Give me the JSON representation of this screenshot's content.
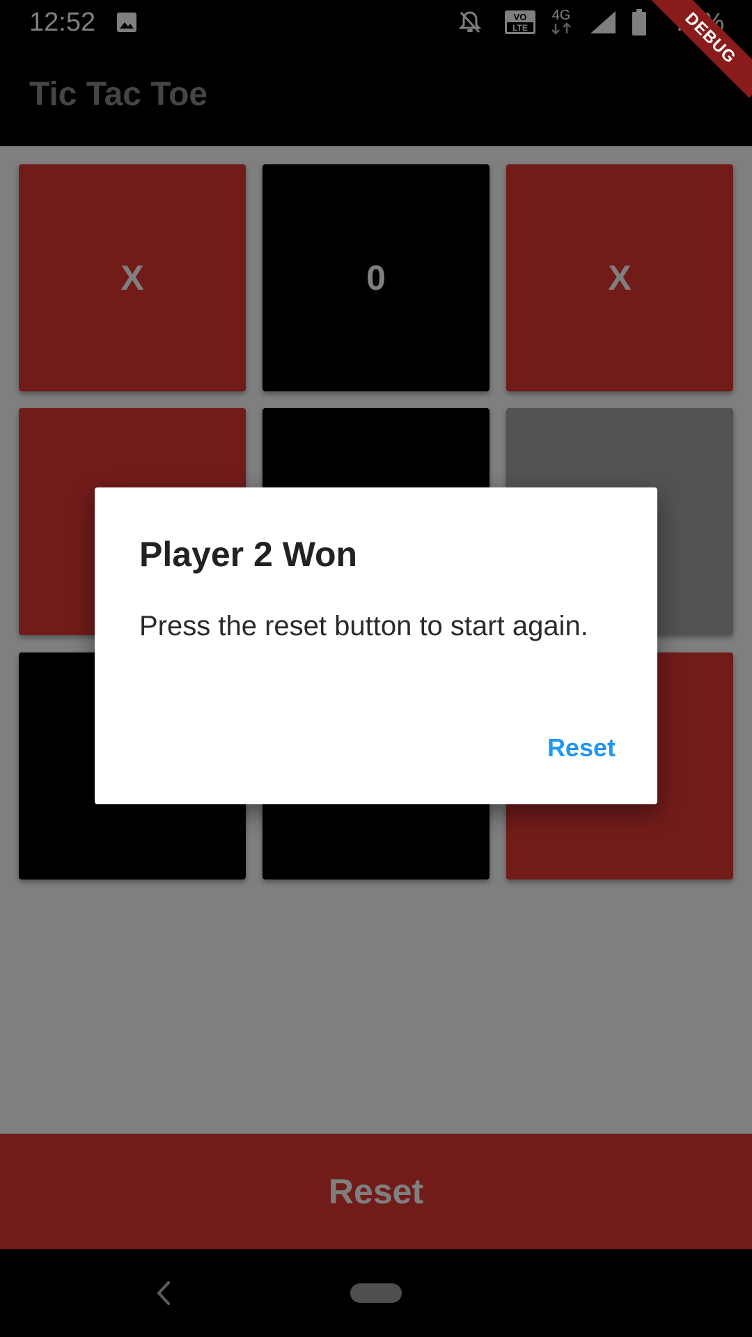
{
  "status_bar": {
    "time": "12:52",
    "battery": "77%",
    "network": "4G",
    "volte": "VO LTE",
    "icons": [
      "gallery-icon",
      "notifications-off-icon",
      "volte-icon",
      "4g-icon",
      "signal-icon",
      "battery-icon"
    ]
  },
  "app_bar": {
    "title": "Tic Tac Toe"
  },
  "debug_banner": {
    "label": "DEBUG"
  },
  "board": {
    "cells": [
      {
        "mark": "X",
        "color": "#e53935"
      },
      {
        "mark": "0",
        "color": "#000000"
      },
      {
        "mark": "X",
        "color": "#e53935"
      },
      {
        "mark": "",
        "color": "#e53935"
      },
      {
        "mark": "",
        "color": "#000000"
      },
      {
        "mark": "",
        "color": "#a6a6a6"
      },
      {
        "mark": "",
        "color": "#000000"
      },
      {
        "mark": "",
        "color": "#000000"
      },
      {
        "mark": "",
        "color": "#e53935"
      }
    ]
  },
  "reset_bar": {
    "label": "Reset"
  },
  "dialog": {
    "title": "Player 2 Won",
    "message": "Press the reset button to start again.",
    "action_label": "Reset"
  },
  "nav_bar": {
    "icons": [
      "back-icon",
      "home-icon"
    ]
  },
  "colors": {
    "accent": "#2196f3",
    "red": "#e53935",
    "grey_cell": "#a6a6a6"
  }
}
